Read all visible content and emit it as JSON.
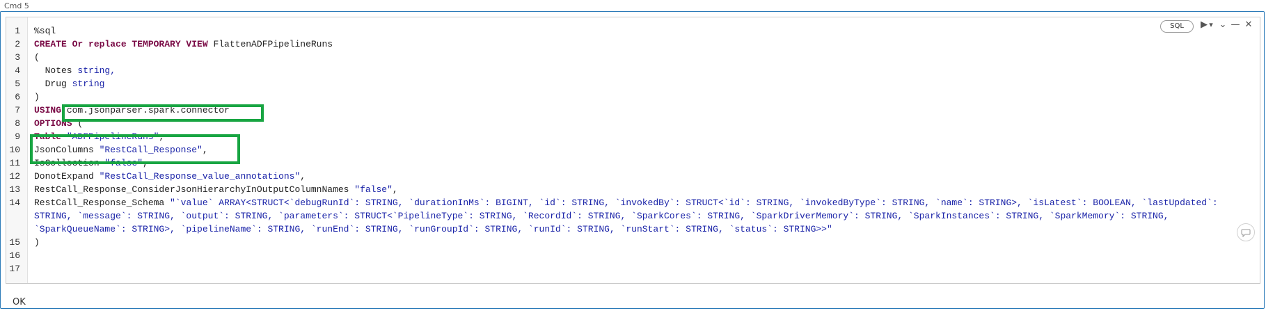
{
  "cmd_label": "Cmd 5",
  "toolbar": {
    "language_badge": "SQL",
    "run_icon": "▶",
    "run_menu_icon": "▾",
    "expand_icon": "⌄",
    "minimize_icon": "—",
    "close_icon": "✕"
  },
  "line_numbers": [
    "1",
    "2",
    "3",
    "4",
    "5",
    "6",
    "7",
    "8",
    "9",
    "10",
    "11",
    "12",
    "13",
    "14",
    "15",
    "16",
    "17"
  ],
  "code": {
    "l1": "%sql",
    "l2_kw": "CREATE Or replace TEMPORARY VIEW",
    "l2_name": " FlattenADFPipelineRuns",
    "l3": "(",
    "l4_name": "  Notes ",
    "l4_type": "string,",
    "l5_name": "  Drug ",
    "l5_type": "string",
    "l6": ")",
    "l7_kw": "USING",
    "l7_rest": " com.jsonparser.spark.connector",
    "l8_kw": "OPTIONS",
    "l8_rest": " (",
    "l9_kw": "Table",
    "l9_str": " \"ADFPipelineRuns\"",
    "l9_end": ",",
    "l10_name": "JsonColumns ",
    "l10_str": "\"RestCall_Response\"",
    "l10_end": ",",
    "l11_name": "IsCollection ",
    "l11_str": "\"false\"",
    "l11_end": ",",
    "l12_name": "DonotExpand ",
    "l12_str": "\"RestCall_Response_value_annotations\"",
    "l12_end": ",",
    "l13_name": "RestCall_Response_ConsiderJsonHierarchyInOutputColumnNames ",
    "l13_str": "\"false\"",
    "l13_end": ",",
    "l14_name": "RestCall_Response_Schema ",
    "l14_str_a": "\"`value` ARRAY<STRUCT<`debugRunId`: STRING, `durationInMs`: BIGINT, `id`: STRING, `invokedBy`: STRUCT<`id`: STRING, `invokedByType`: STRING, `name`: STRING>, `isLatest`: BOOLEAN, `lastUpdated`:",
    "l14_str_b": "STRING, `message`: STRING, `output`: STRING, `parameters`: STRUCT<`PipelineType`: STRING, `RecordId`: STRING, `SparkCores`: STRING, `SparkDriverMemory`: STRING, `SparkInstances`: STRING, `SparkMemory`: STRING,",
    "l14_str_c": "`SparkQueueName`: STRING>, `pipelineName`: STRING, `runEnd`: STRING, `runGroupId`: STRING, `runId`: STRING, `runStart`: STRING, `status`: STRING>>\"",
    "l15": ")"
  },
  "result_text": "OK",
  "colors": {
    "keyword": "#7a0b46",
    "string": "#1a23a8",
    "highlight_box": "#18a542",
    "cell_border": "#2a7ab8"
  }
}
